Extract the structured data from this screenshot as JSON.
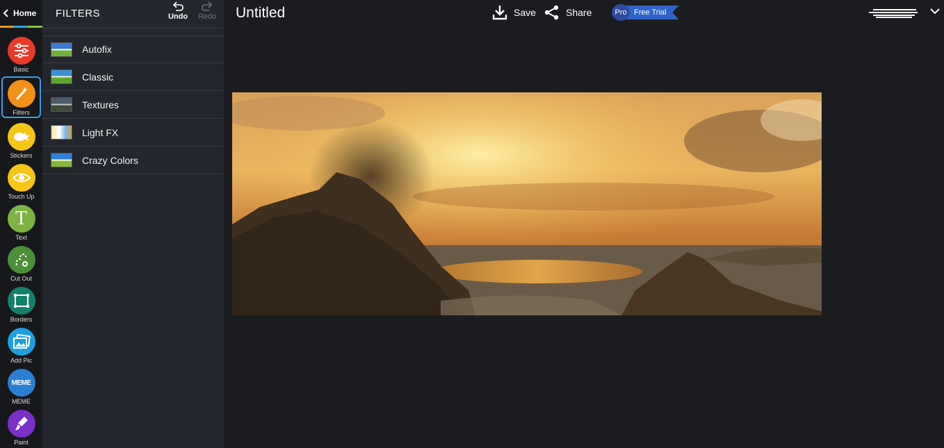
{
  "nav": {
    "home_label": "Home"
  },
  "tools": [
    {
      "label": "Basic",
      "color": "#e8392b",
      "icon": "sliders-icon"
    },
    {
      "label": "Filters",
      "color": "#f39019",
      "icon": "magic-wand-icon",
      "active": true
    },
    {
      "label": "Stickers",
      "color": "#f5c518",
      "icon": "sticker-icon"
    },
    {
      "label": "Touch Up",
      "color": "#f5c518",
      "icon": "eye-icon"
    },
    {
      "label": "Text",
      "color": "#7cb342",
      "icon": "text-t-icon"
    },
    {
      "label": "Cut Out",
      "color": "#4a8f3a",
      "icon": "cutout-icon"
    },
    {
      "label": "Borders",
      "color": "#13806b",
      "icon": "frame-icon"
    },
    {
      "label": "Add Pic",
      "color": "#1ea0e0",
      "icon": "add-picture-icon"
    },
    {
      "label": "MEME",
      "color": "#2a7fd4",
      "icon": "meme-icon",
      "icon_text": "MEME"
    },
    {
      "label": "Paint",
      "color": "#7b2fc9",
      "icon": "paint-brush-icon"
    }
  ],
  "panel": {
    "title": "FILTERS",
    "undo_label": "Undo",
    "redo_label": "Redo",
    "filters": [
      {
        "label": "Autofix"
      },
      {
        "label": "Classic"
      },
      {
        "label": "Textures"
      },
      {
        "label": "Light FX"
      },
      {
        "label": "Crazy Colors"
      }
    ]
  },
  "topbar": {
    "doc_title": "Untitled",
    "save_label": "Save",
    "share_label": "Share",
    "pro_label": "Pro",
    "free_trial_label": "Free Trial"
  },
  "colors": {
    "accent_blue": "#2ea3f2",
    "panel_bg": "#23262c",
    "canvas_bg": "#1b1c1f"
  }
}
